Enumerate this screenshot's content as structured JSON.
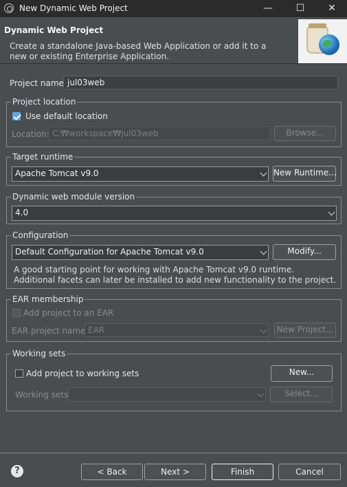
{
  "window": {
    "title": "New Dynamic Web Project",
    "minimize": "—",
    "maximize": "☐",
    "close": "✕"
  },
  "header": {
    "title": "Dynamic Web Project",
    "description": "Create a standalone Java-based Web Application or add it to a new or existing Enterprise Application."
  },
  "project_name": {
    "label": "Project name:",
    "value": "jul03web"
  },
  "project_location": {
    "legend": "Project location",
    "use_default_label": "Use default location",
    "use_default_checked": true,
    "location_label": "Location:",
    "location_value": "C:₩workspace₩jul03web",
    "browse_label": "Browse..."
  },
  "target_runtime": {
    "legend": "Target runtime",
    "value": "Apache Tomcat v9.0",
    "new_runtime_label": "New Runtime..."
  },
  "module_version": {
    "legend": "Dynamic web module version",
    "value": "4.0"
  },
  "configuration": {
    "legend": "Configuration",
    "value": "Default Configuration for Apache Tomcat v9.0",
    "modify_label": "Modify...",
    "description": "A good starting point for working with Apache Tomcat v9.0 runtime. Additional facets can later be installed to add new functionality to the project."
  },
  "ear": {
    "legend": "EAR membership",
    "add_label": "Add project to an EAR",
    "project_label": "EAR project name:",
    "project_value": "EAR",
    "new_project_label": "New Project..."
  },
  "working_sets": {
    "legend": "Working sets",
    "add_label": "Add project to working sets",
    "new_label": "New...",
    "sets_label": "Working sets:",
    "sets_value": "",
    "select_label": "Select..."
  },
  "footer": {
    "help": "?",
    "back": "< Back",
    "next": "Next >",
    "finish": "Finish",
    "cancel": "Cancel"
  }
}
